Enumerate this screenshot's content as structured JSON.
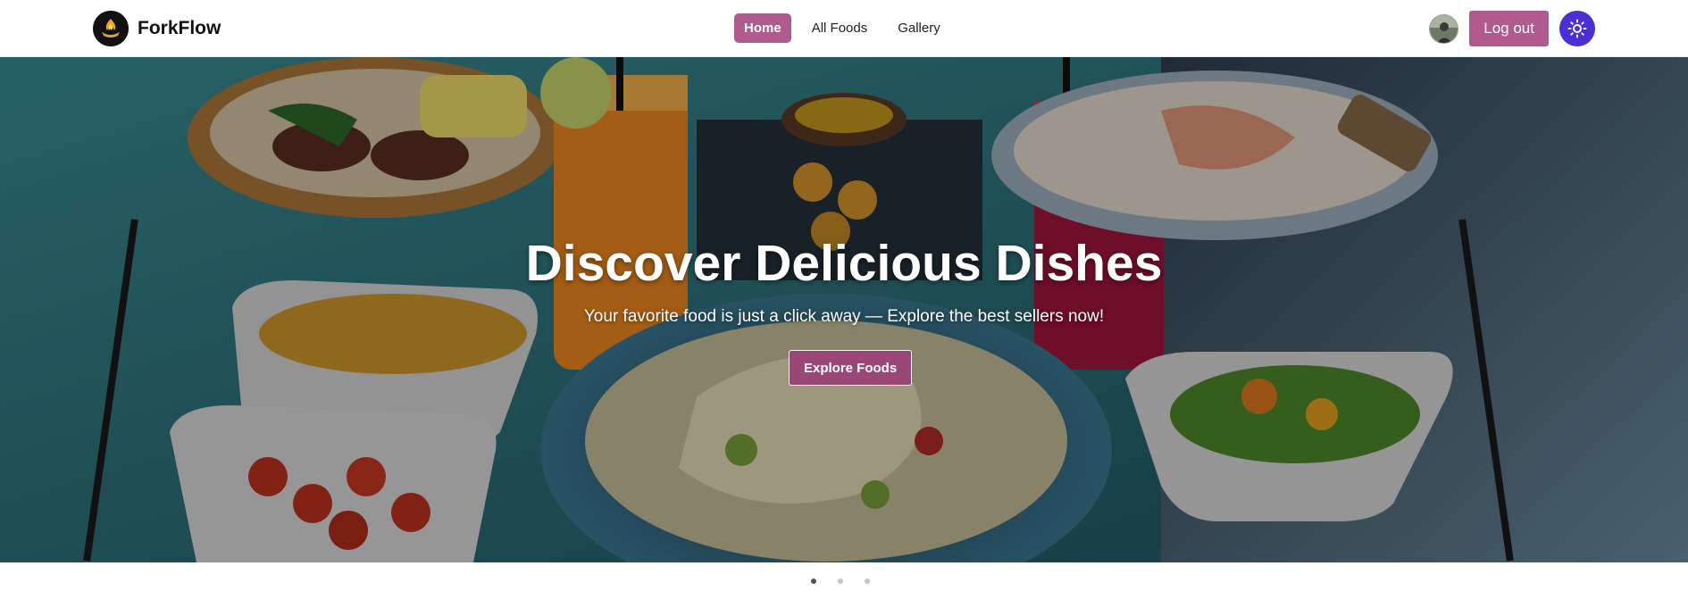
{
  "brand": {
    "name": "ForkFlow",
    "logo_icon": "flame-bowl-icon"
  },
  "nav": {
    "links": [
      {
        "label": "Home",
        "active": true
      },
      {
        "label": "All Foods",
        "active": false
      },
      {
        "label": "Gallery",
        "active": false
      }
    ]
  },
  "user": {
    "avatar_icon": "user-avatar",
    "logout_label": "Log out",
    "theme_icon": "sun-icon"
  },
  "hero": {
    "title": "Discover Delicious Dishes",
    "subtitle": "Your favorite food is just a click away — Explore the best sellers now!",
    "cta_label": "Explore Foods"
  },
  "carousel": {
    "slide_count": 3,
    "active_index": 0
  },
  "colors": {
    "accent": "#b15a90",
    "cta": "#9a4778",
    "theme_button": "#4b2fd6"
  }
}
